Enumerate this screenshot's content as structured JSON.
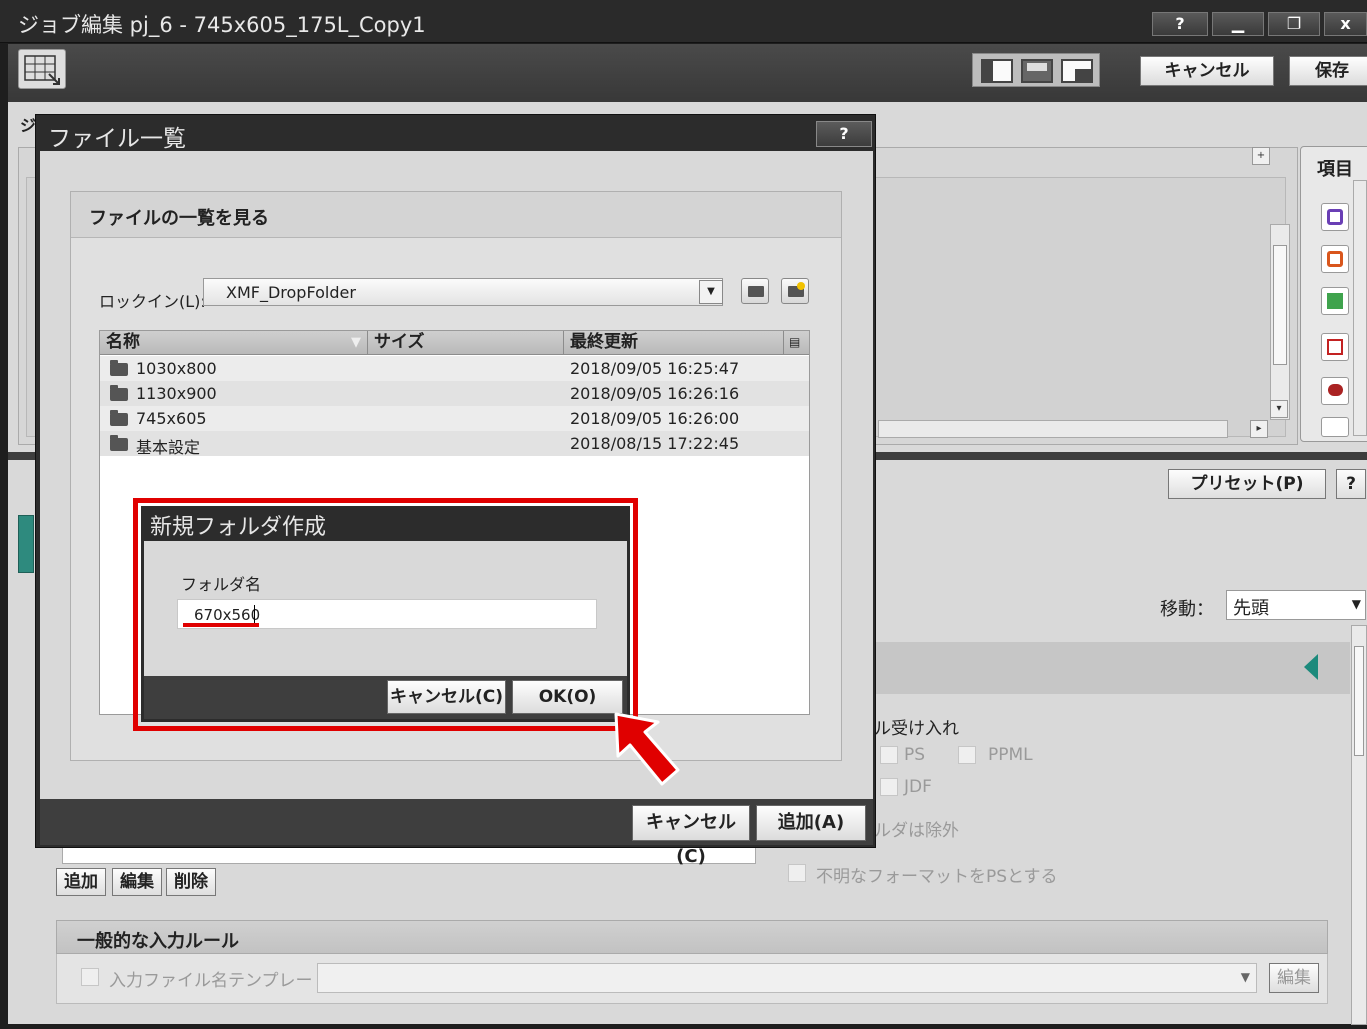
{
  "window": {
    "title": "ジョブ編集 pj_6 - 745x605_175L_Copy1",
    "help": "?",
    "minimize": "▁",
    "restore": "❐",
    "close": "x",
    "cancel": "キャンセル",
    "save": "保存"
  },
  "right_panel": {
    "title": "項目"
  },
  "background": {
    "tab_edge": "ジ",
    "preset": "プリセット(P)",
    "preset_help": "?",
    "move_label": "移動：",
    "move_value": "先頭",
    "accept_label": "ル受け入れ",
    "fmt_ps": "PS",
    "fmt_ppml": "PPML",
    "fmt_jdf": "JDF",
    "exclude_label": "ルダは除外",
    "unknown_ps": "不明なフォーマットをPSとする",
    "btn_add": "追加",
    "btn_edit": "編集",
    "btn_delete": "削除",
    "general_rules": "一般的な入力ルール",
    "filename_template": "入力ファイル名テンプレート",
    "template_edit": "編集"
  },
  "file_dialog": {
    "title": "ファイル一覧",
    "help": "?",
    "section_title": "ファイルの一覧を見る",
    "lookin_label": "ロックイン(L):",
    "lookin_value": "XMF_DropFolder",
    "columns": [
      "名称",
      "サイズ",
      "最終更新"
    ],
    "files": [
      {
        "name": "1030x800",
        "modified": "2018/09/05 16:25:47"
      },
      {
        "name": "1130x900",
        "modified": "2018/09/05 16:26:16"
      },
      {
        "name": "745x605",
        "modified": "2018/09/05 16:26:00"
      },
      {
        "name": "基本設定",
        "modified": "2018/08/15 17:22:45"
      }
    ],
    "cancel": "キャンセル(C)",
    "add": "追加(A)"
  },
  "new_folder_dialog": {
    "title": "新規フォルダ作成",
    "folder_label": "フォルダ名",
    "folder_value": "670x560",
    "cancel": "キャンセル(C)",
    "ok": "OK(O)"
  },
  "colors": {
    "highlight": "#e00000",
    "dialog_frame": "#2c2c2c",
    "workarea": "#d9d9d9"
  }
}
